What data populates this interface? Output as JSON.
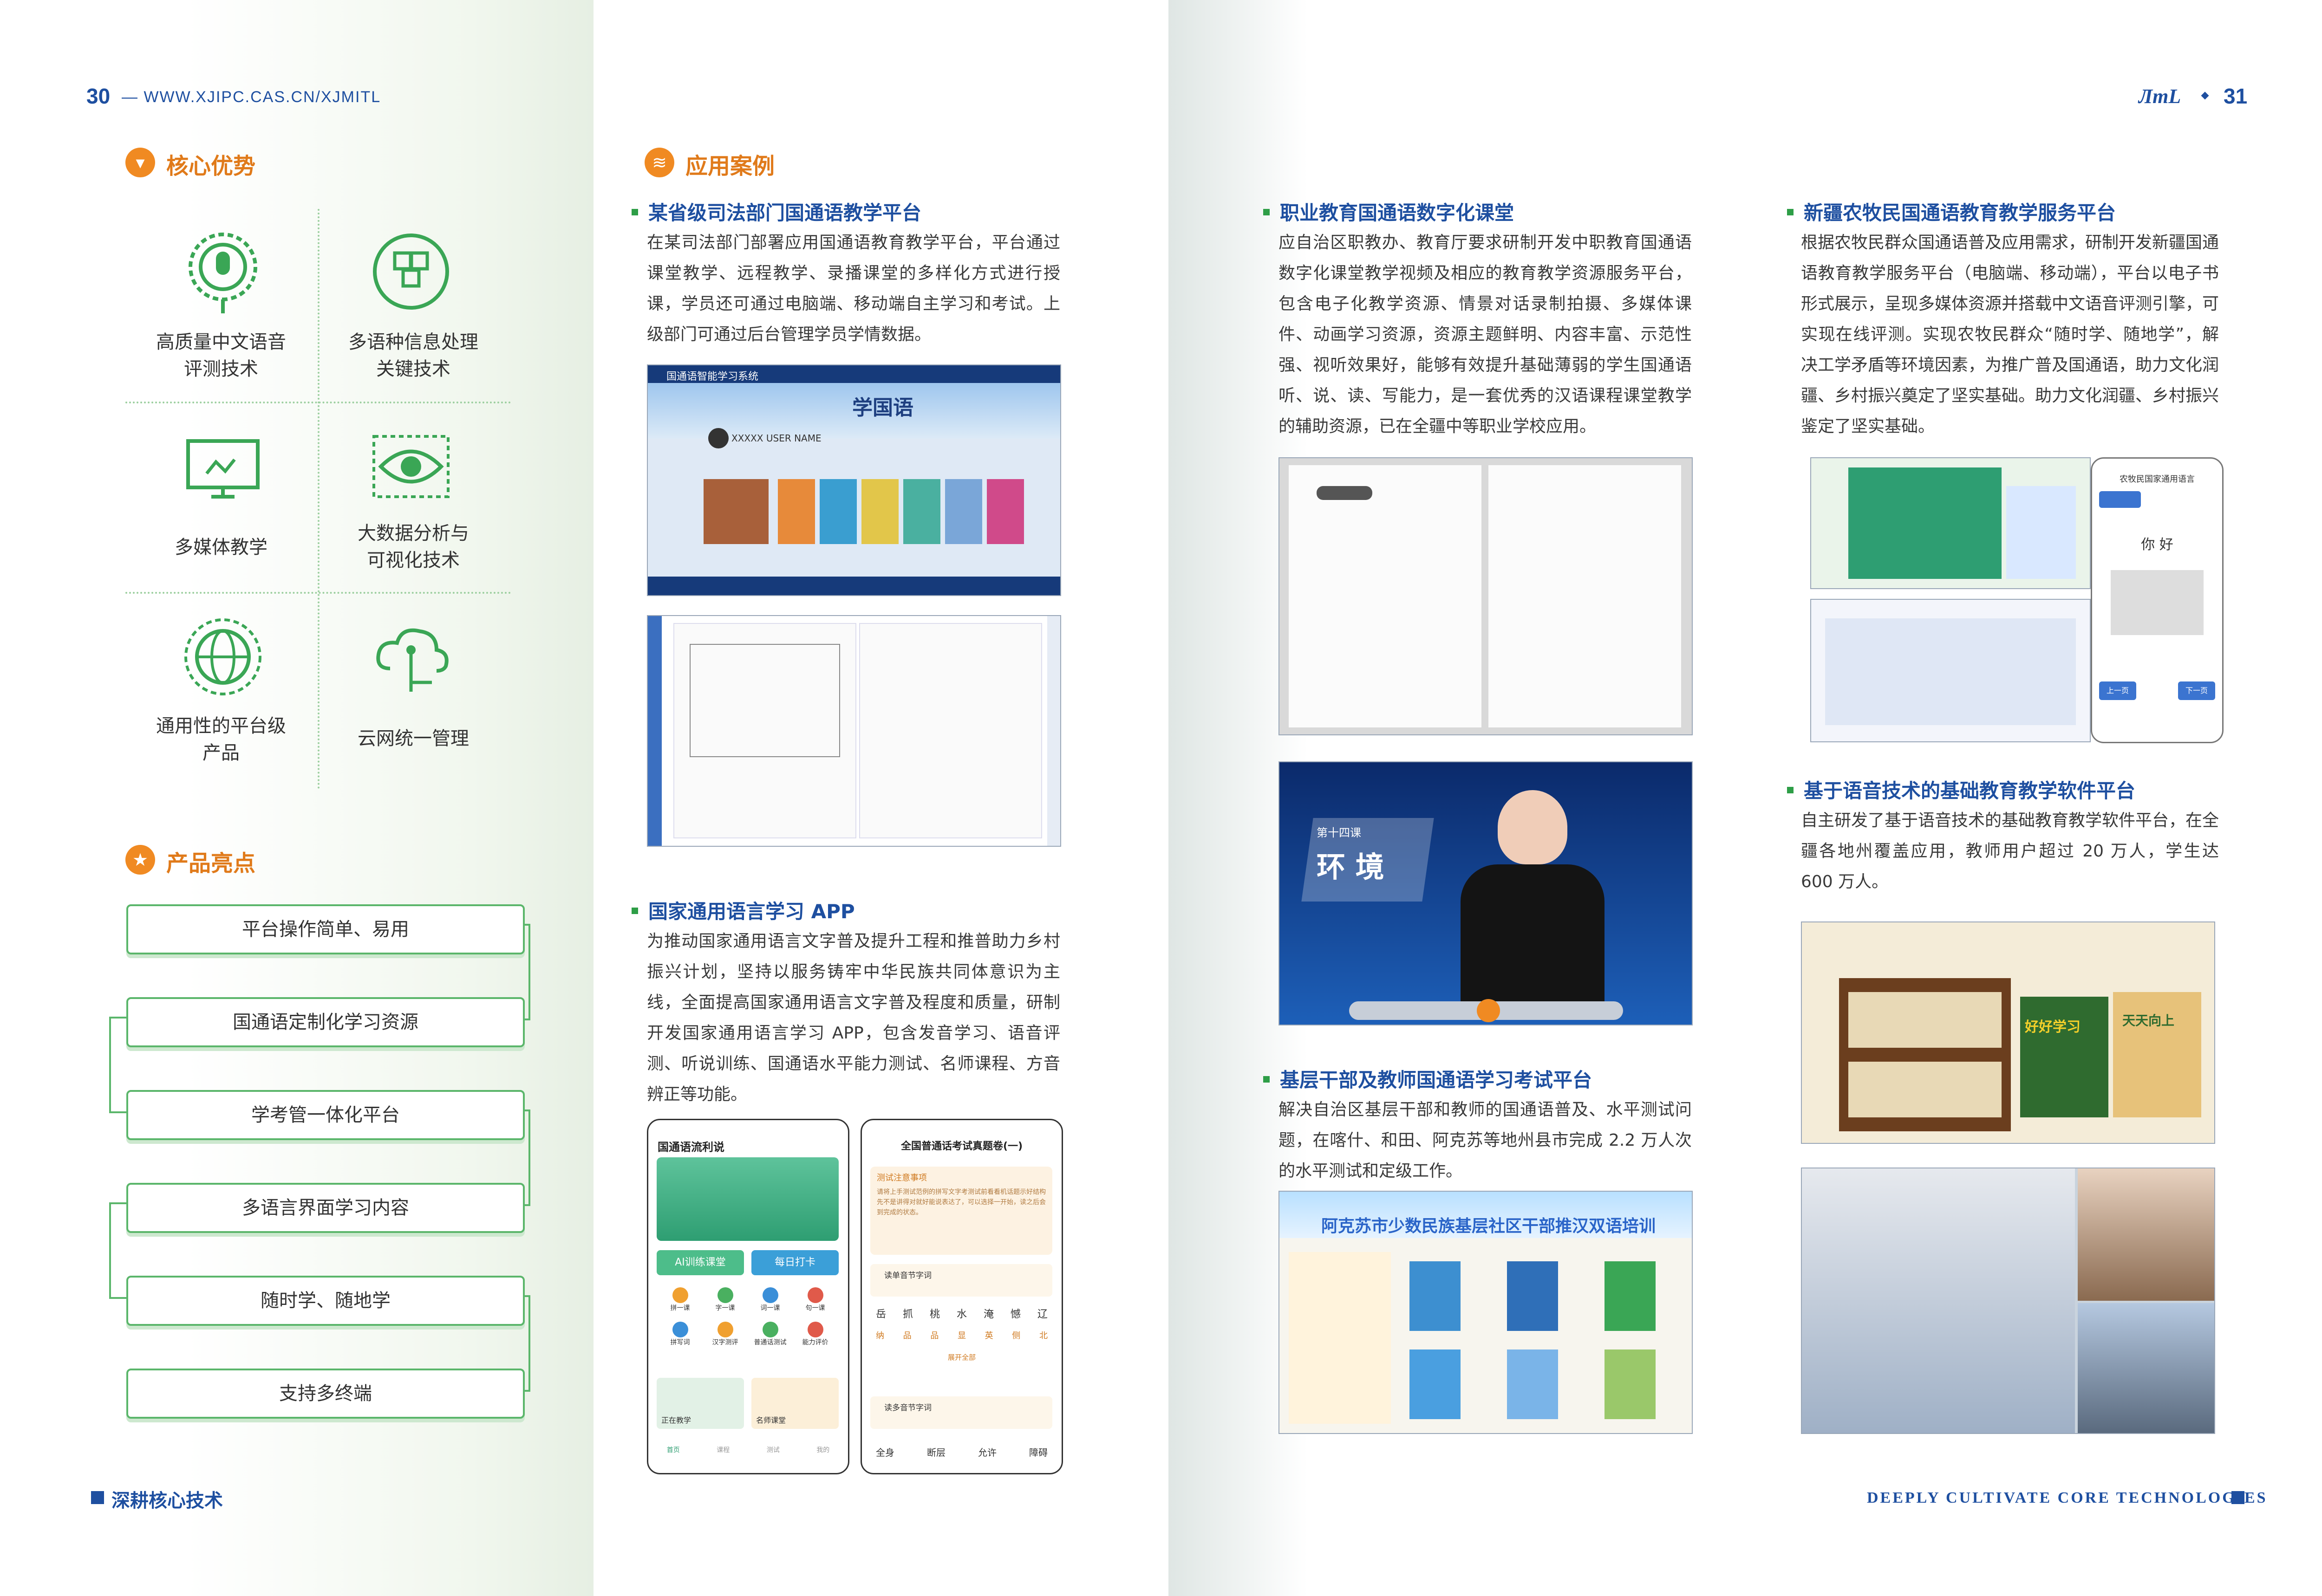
{
  "left_page": {
    "page_number": "30",
    "url": "— WWW.XJIPC.CAS.CN/XJMITL",
    "core_section": {
      "title": "核心优势",
      "tiles": [
        {
          "label": "高质量中文语音\n评测技术",
          "icon": "microphone-icon"
        },
        {
          "label": "多语种信息处理\n关键技术",
          "icon": "cube-cluster-icon"
        },
        {
          "label": "多媒体教学",
          "icon": "monitor-icon"
        },
        {
          "label": "大数据分析与\n可视化技术",
          "icon": "eye-icon"
        },
        {
          "label": "通用性的平台级\n产品",
          "icon": "globe-icon"
        },
        {
          "label": "云网统一管理",
          "icon": "cloud-icon"
        }
      ]
    },
    "highlight_section": {
      "title": "产品亮点",
      "items": [
        "平台操作简单、易用",
        "国通语定制化学习资源",
        "学考管一体化平台",
        "多语言界面学习内容",
        "随时学、随地学",
        "支持多终端"
      ]
    },
    "footer": "深耕核心技术"
  },
  "cases": {
    "section_title": "应用案例",
    "case1": {
      "title": "某省级司法部门国通语教学平台",
      "body": "在某司法部门部署应用国通语教育教学平台，平台通过课堂教学、远程教学、录播课堂的多样化方式进行授课，学员还可通过电脑端、移动端自主学习和考试。上级部门可通过后台管理学员学情数据。",
      "shot1_header": "国通语智能学习系统",
      "shot1_banner": "学国语",
      "shot1_user": "XXXXX USER NAME"
    },
    "case2": {
      "title": "国家通用语言学习 APP",
      "body": "为推动国家通用语言文字普及提升工程和推普助力乡村振兴计划，坚持以服务铸牢中华民族共同体意识为主线，全面提高国家通用语言文字普及程度和质量，研制开发国家通用语言学习 APP，包含发音学习、语音评测、听说训练、国通语水平能力测试、名师课程、方音辨正等功能。",
      "phone1": {
        "header": "国通语流利说",
        "btn1": "AI训练课堂",
        "btn2": "每日打卡",
        "grid": [
          "拼一课",
          "字一课",
          "词一课",
          "句一课",
          "拼写词",
          "汉字测评",
          "普通话测试",
          "能力评价"
        ],
        "card1": "正在教学",
        "card2": "名师课堂",
        "nav": [
          "首页",
          "课程",
          "测试",
          "我的"
        ]
      },
      "phone2": {
        "header": "全国普通话考试真题卷(一)",
        "notice_title": "测试注意事项",
        "notice_body": "请将上手测试范例的拼写文字考测试前看看机话题示好结构先不是讲得对就好能说表达了，可以选择一开始，读之后会到完成的状态。",
        "q1": "读单音节字词",
        "chars_row1": [
          "岳",
          "抓",
          "桃",
          "水",
          "淹",
          "憾",
          "辽"
        ],
        "chars_row2": [
          "纳",
          "品",
          "品",
          "显",
          "英",
          "侧",
          "北"
        ],
        "more": "展开全部",
        "q2": "读多音节字词",
        "bottom": [
          "全身",
          "断层",
          "允许",
          "障碍"
        ]
      }
    },
    "case3": {
      "title": "职业教育国通语数字化课堂",
      "body": "应自治区职教办、教育厅要求研制开发中职教育国通语数字化课堂教学视频及相应的教育教学资源服务平台，包含电子化教学资源、情景对话录制拍摄、多媒体课件、动画学习资源，资源主题鲜明、内容丰富、示范性强、视听效果好，能够有效提升基础薄弱的学生国通语听、说、读、写能力，是一套优秀的汉语课程课堂教学的辅助资源，已在全疆中等职业学校应用。",
      "video_tag": "第十四课",
      "video_title": "环 境"
    },
    "case4": {
      "title": "基层干部及教师国通语学习考试平台",
      "body": "解决自治区基层干部和教师的国通语普及、水平测试问题，在喀什、和田、阿克苏等地州县市完成 2.2 万人次的水平测试和定级工作。",
      "banner": "阿克苏市少数民族基层社区干部推汉双语培训"
    },
    "case5": {
      "title": "新疆农牧民国通语教育教学服务平台",
      "body": "根据农牧民群众国通语普及应用需求，研制开发新疆国通语教育教学服务平台（电脑端、移动端），平台以电子书形式展示，呈现多媒体资源并搭载中文语音评测引擎，可实现在线评测。实现农牧民群众“随时学、随地学”，解决工学矛盾等环境因素，为推广普及国通语，助力文化润疆、乡村振兴奠定了坚实基础。助力文化润疆、乡村振兴鉴定了坚实基础。",
      "phone_header": "农牧民国家通用语言",
      "phone_word": "你 好",
      "phone_buttons": [
        "上一页",
        "下一页"
      ]
    },
    "case6": {
      "title": "基于语音技术的基础教育教学软件平台",
      "body": "自主研发了基于语音技术的基础教育教学软件平台，在全疆各地州覆盖应用，教师用户超过 20 万人，学生达 600 万人。",
      "book1": "好好学习",
      "book2": "天天向上"
    },
    "page_number": "31",
    "footer": "DEEPLY CULTIVATE CORE TECHNOLOGIES"
  },
  "colors": {
    "brand_blue": "#1e4fa0",
    "brand_green": "#2e9e47",
    "accent_orange": "#f08a22"
  }
}
